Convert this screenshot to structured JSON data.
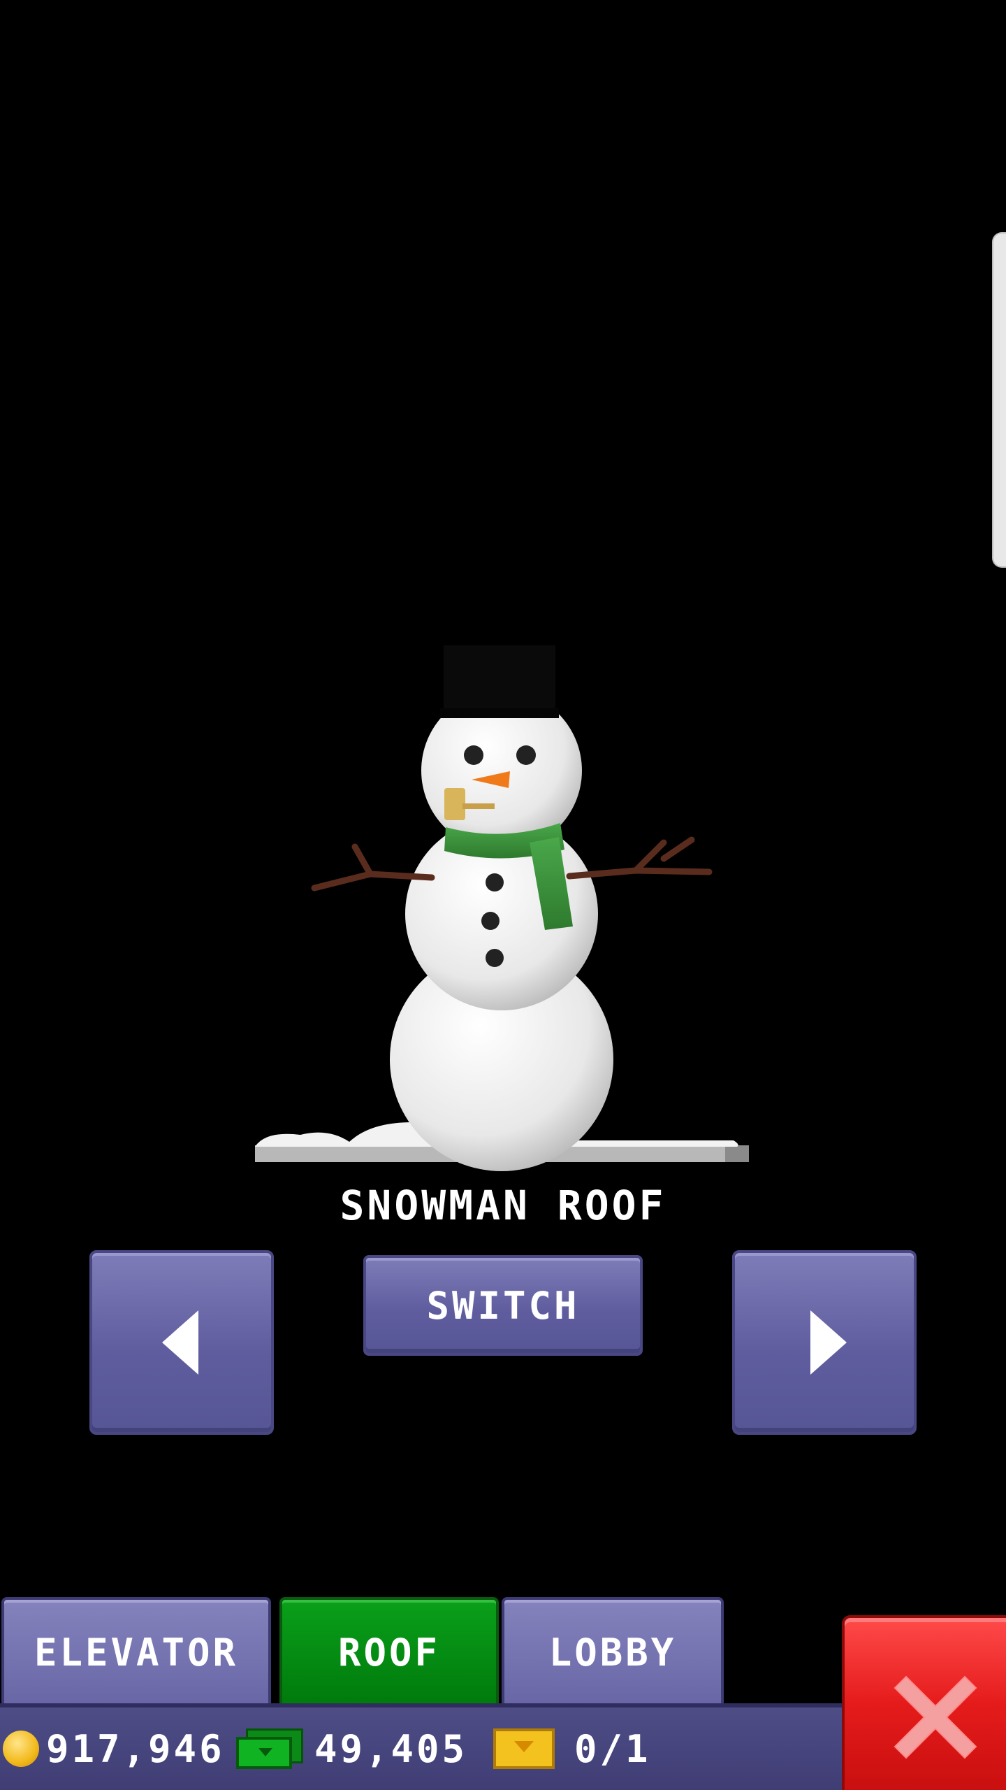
{
  "preview": {
    "item_name": "SNOWMAN ROOF"
  },
  "controls": {
    "switch_label": "SWITCH",
    "prev_icon": "arrow-left-icon",
    "next_icon": "arrow-right-icon"
  },
  "tabs": [
    {
      "label": "ELEVATOR",
      "active": false
    },
    {
      "label": "ROOF",
      "active": true
    },
    {
      "label": "LOBBY",
      "active": false
    }
  ],
  "status": {
    "coins": "917,946",
    "bux": "49,405",
    "tickets": "0/1"
  },
  "colors": {
    "button": "#6664a6",
    "active_tab": "#008a10",
    "close": "#e51b1b"
  }
}
